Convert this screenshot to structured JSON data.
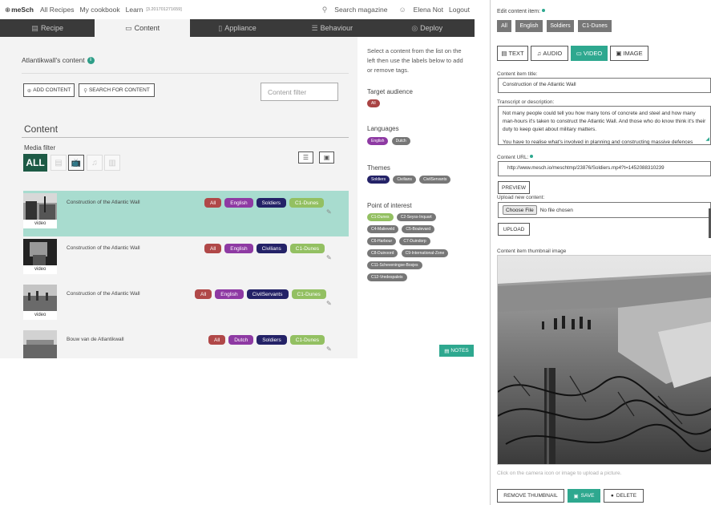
{
  "topbar": {
    "logo": "⊕",
    "brand": "meSch",
    "nav": [
      "All Recipes",
      "My cookbook",
      "Learn"
    ],
    "version": "[3.201701271659]",
    "search_label": "Search magazine",
    "user_name": "Elena Not",
    "logout_label": "Logout"
  },
  "tabs": [
    {
      "label": "Recipe",
      "icon": "document-icon",
      "glyph": "▤"
    },
    {
      "label": "Content",
      "icon": "monitor-icon",
      "glyph": "▭"
    },
    {
      "label": "Appliance",
      "icon": "device-icon",
      "glyph": "▯"
    },
    {
      "label": "Behaviour",
      "icon": "list-icon",
      "glyph": "☰"
    },
    {
      "label": "Deploy",
      "icon": "target-icon",
      "glyph": "◎"
    }
  ],
  "active_tab": "Content",
  "content_page": {
    "title": "Atlantikwall's content",
    "add_content_label": "ADD CONTENT",
    "search_content_label": "SEARCH FOR CONTENT",
    "filter_placeholder": "Content filter",
    "section_title": "Content",
    "media_filter_label": "Media filter",
    "media_filter_all": "ALL",
    "media_filters": [
      "text",
      "image",
      "video",
      "audio",
      "document"
    ],
    "selected_media_filter": "video",
    "items": [
      {
        "title": "Construction of the Atlantic Wall",
        "type": "video",
        "selected": true,
        "tags": [
          {
            "text": "All",
            "kind": "all"
          },
          {
            "text": "English",
            "kind": "lang"
          },
          {
            "text": "Soldiers",
            "kind": "theme"
          },
          {
            "text": "C1-Dunes",
            "kind": "poi"
          }
        ]
      },
      {
        "title": "Construction of the Atlantic Wall",
        "type": "video",
        "selected": false,
        "tags": [
          {
            "text": "All",
            "kind": "all"
          },
          {
            "text": "English",
            "kind": "lang"
          },
          {
            "text": "Civilians",
            "kind": "theme"
          },
          {
            "text": "C1-Dunes",
            "kind": "poi"
          }
        ]
      },
      {
        "title": "Construction of the Atlantic Wall",
        "type": "video",
        "selected": false,
        "tags": [
          {
            "text": "All",
            "kind": "all"
          },
          {
            "text": "English",
            "kind": "lang"
          },
          {
            "text": "CivilServants",
            "kind": "theme"
          },
          {
            "text": "C1-Dunes",
            "kind": "poi"
          }
        ]
      },
      {
        "title": "Bouw van de Atlantikwall",
        "type": "",
        "selected": false,
        "tags": [
          {
            "text": "All",
            "kind": "all"
          },
          {
            "text": "Dutch",
            "kind": "lang"
          },
          {
            "text": "Soldiers",
            "kind": "theme"
          },
          {
            "text": "C1-Dunes",
            "kind": "poi"
          }
        ]
      }
    ]
  },
  "sidebar": {
    "intro": "Select a content from the list on the left then use the labels below to add or remove tags.",
    "target_audience_label": "Target audience",
    "target_audience": [
      "All"
    ],
    "languages_label": "Languages",
    "languages": [
      {
        "text": "English",
        "color": "purple"
      },
      {
        "text": "Dutch",
        "color": "grey"
      }
    ],
    "themes_label": "Themes",
    "themes": [
      {
        "text": "Soldiers",
        "color": "navy"
      },
      {
        "text": "Civilians",
        "color": "grey"
      },
      {
        "text": "CivilServants",
        "color": "grey"
      }
    ],
    "poi_label": "Point of interest",
    "poi": [
      {
        "text": "C1-Dunes",
        "color": "green"
      },
      {
        "text": "C2-Seyss-Inquart",
        "color": "grey"
      },
      {
        "text": "C4-Malieveld",
        "color": "grey"
      },
      {
        "text": "C5-Boulevard",
        "color": "grey"
      },
      {
        "text": "C6-Harbour",
        "color": "grey"
      },
      {
        "text": "C7-Duindorp",
        "color": "grey"
      },
      {
        "text": "C8-Duinoord",
        "color": "grey"
      },
      {
        "text": "C9-International-Zone",
        "color": "grey"
      },
      {
        "text": "C11-Scheveningse-Bosjes",
        "color": "grey"
      },
      {
        "text": "C12-Vredespaleis",
        "color": "grey"
      }
    ],
    "notes_label": "NOTES"
  },
  "edit_panel": {
    "heading": "Edit content item:",
    "tags": [
      "All",
      "English",
      "Soldiers",
      "C1-Dunes"
    ],
    "types": [
      "TEXT",
      "AUDIO",
      "VIDEO",
      "IMAGE"
    ],
    "active_type": "VIDEO",
    "title_label": "Content item title:",
    "title_value": "Construction of the Atlantic Wall",
    "transcript_label": "Transcript or description:",
    "transcript_value": "Not many people could tell you how many tons of concrete and steel and how many man-hours it's taken to construct the Atlantic Wall. And those who do know think it's their duty to keep quiet about military matters.",
    "transcript_more": "You have to realise what's involved in planning and constructing massive defences",
    "url_label": "Content URL:",
    "url_value": "http://www.mesch.io/meschtmp/23876/Soldiers.mp4?t=1452088310239",
    "preview_label": "PREVIEW",
    "upload_label": "Upload new content:",
    "choose_file_label": "Choose File",
    "no_file_label": "No file chosen",
    "upload_button_label": "UPLOAD",
    "thumbnail_label": "Content item thumbnail image",
    "thumbnail_hint": "Click on the camera icon or image to upload a picture.",
    "remove_thumbnail_label": "REMOVE THUMBNAIL",
    "save_label": "SAVE",
    "delete_label": "DELETE"
  },
  "colors": {
    "accent": "#2ea88f",
    "selected_row": "#a8dccf",
    "tabbar": "#3a3a3a",
    "tag_all": "#b04848",
    "tag_language": "#8e3aa3",
    "tag_theme": "#242267",
    "tag_poi": "#93c062",
    "media_all": "#1d5a45"
  }
}
